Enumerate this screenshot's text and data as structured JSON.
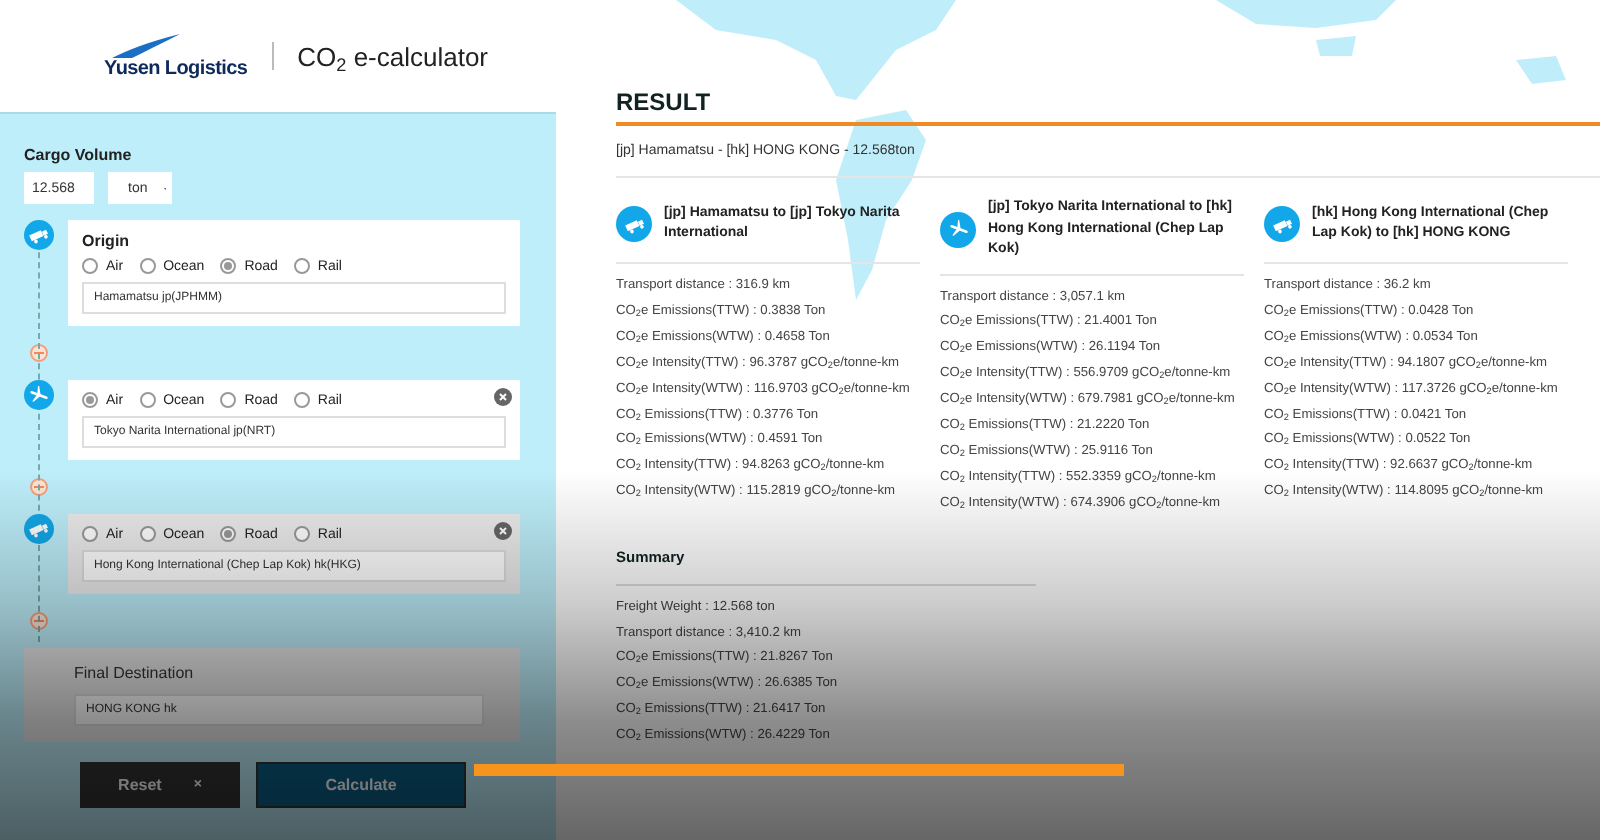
{
  "header": {
    "logo": "Yusen Logistics",
    "title": "CO$_{2}$ e-calculator"
  },
  "cargo": {
    "label": "Cargo Volume",
    "value": "12.568",
    "unit": "ton"
  },
  "segments": [
    {
      "label": "Origin",
      "removable": false,
      "highlighted": false,
      "modes": [
        {
          "label": "Air",
          "selected": false
        },
        {
          "label": "Ocean",
          "selected": false
        },
        {
          "label": "Road",
          "selected": true
        },
        {
          "label": "Rail",
          "selected": false
        }
      ],
      "location": "Hamamatsu jp(JPHMM)"
    },
    {
      "removable": true,
      "highlighted": false,
      "modes": [
        {
          "label": "Air",
          "selected": true
        },
        {
          "label": "Ocean",
          "selected": false
        },
        {
          "label": "Road",
          "selected": false
        },
        {
          "label": "Rail",
          "selected": false
        }
      ],
      "location": "Tokyo Narita International jp(NRT)"
    },
    {
      "removable": true,
      "highlighted": true,
      "modes": [
        {
          "label": "Air",
          "selected": false
        },
        {
          "label": "Ocean",
          "selected": false
        },
        {
          "label": "Road",
          "selected": true
        },
        {
          "label": "Rail",
          "selected": false
        }
      ],
      "location": "Hong Kong International (Chep Lap Kok) hk(HKG)"
    }
  ],
  "final_destination": {
    "label": "Final Destination",
    "value": "HONG KONG hk"
  },
  "buttons": {
    "reset": "Reset",
    "reset_icon": "×",
    "calculate": "Calculate"
  },
  "result": {
    "title": "RESULT",
    "route": "[jp] Hamamatsu - [hk] HONG KONG - 12.568ton",
    "legs": [
      {
        "title": "[jp] Hamamatsu to [jp] Tokyo Narita International",
        "rows": [
          "Transport distance : 316.9 km",
          "CO$_{2}$e Emissions(TTW) : 0.3838 Ton",
          "CO$_{2}$e Emissions(WTW) : 0.4658 Ton",
          "CO$_{2}$e Intensity(TTW) : 96.3787 gCO$_{2}$e/tonne-km",
          "CO$_{2}$e Intensity(WTW) : 116.9703 gCO$_{2}$e/tonne-km",
          "CO$_{2}$ Emissions(TTW) : 0.3776 Ton",
          "CO$_{2}$ Emissions(WTW) : 0.4591 Ton",
          "CO$_{2}$ Intensity(TTW) : 94.8263 gCO$_{2}$/tonne-km",
          "CO$_{2}$ Intensity(WTW) : 115.2819 gCO$_{2}$/tonne-km"
        ]
      },
      {
        "title": "[jp] Tokyo Narita International to [hk] Hong Kong International (Chep Lap Kok)",
        "rows": [
          "Transport distance : 3,057.1 km",
          "CO$_{2}$e Emissions(TTW) : 21.4001 Ton",
          "CO$_{2}$e Emissions(WTW) : 26.1194 Ton",
          "CO$_{2}$e Intensity(TTW) : 556.9709 gCO$_{2}$e/tonne-km",
          "CO$_{2}$e Intensity(WTW) : 679.7981 gCO$_{2}$e/tonne-km",
          "CO$_{2}$ Emissions(TTW) : 21.2220 Ton",
          "CO$_{2}$ Emissions(WTW) : 25.9116 Ton",
          "CO$_{2}$ Intensity(TTW) : 552.3359 gCO$_{2}$/tonne-km",
          "CO$_{2}$ Intensity(WTW) : 674.3906 gCO$_{2}$/tonne-km"
        ]
      },
      {
        "title": "[hk] Hong Kong International (Chep Lap Kok) to [hk] HONG KONG",
        "rows": [
          "Transport distance : 36.2 km",
          "CO$_{2}$e Emissions(TTW) : 0.0428 Ton",
          "CO$_{2}$e Emissions(WTW) : 0.0534 Ton",
          "CO$_{2}$e Intensity(TTW) : 94.1807 gCO$_{2}$e/tonne-km",
          "CO$_{2}$e Intensity(WTW) : 117.3726 gCO$_{2}$e/tonne-km",
          "CO$_{2}$ Emissions(TTW) : 0.0421 Ton",
          "CO$_{2}$ Emissions(WTW) : 0.0522 Ton",
          "CO$_{2}$ Intensity(TTW) : 92.6637 gCO$_{2}$/tonne-km",
          "CO$_{2}$ Intensity(WTW) : 114.8095 gCO$_{2}$/tonne-km"
        ]
      }
    ],
    "summary": {
      "title": "Summary",
      "rows": [
        "Freight Weight : 12.568 ton",
        "Transport distance : 3,410.2 km",
        "CO$_{2}$e Emissions(TTW) : 21.8267 Ton",
        "CO$_{2}$e Emissions(WTW) : 26.6385 Ton",
        "CO$_{2}$ Emissions(TTW) : 21.6417 Ton",
        "CO$_{2}$ Emissions(WTW) : 26.4229 Ton"
      ]
    }
  }
}
